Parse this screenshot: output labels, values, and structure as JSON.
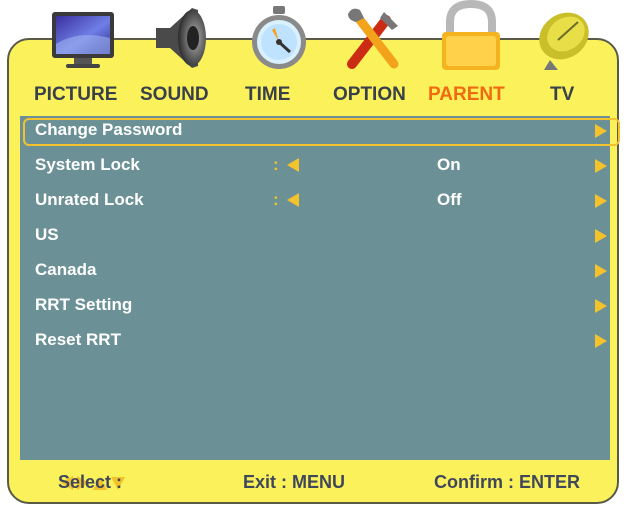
{
  "tabs": [
    {
      "label": "PICTURE",
      "icon": "monitor-icon"
    },
    {
      "label": "SOUND",
      "icon": "speaker-icon"
    },
    {
      "label": "TIME",
      "icon": "stopwatch-icon"
    },
    {
      "label": "OPTION",
      "icon": "tools-icon"
    },
    {
      "label": "PARENT",
      "icon": "padlock-icon",
      "active": true
    },
    {
      "label": "TV",
      "icon": "satellite-dish-icon"
    }
  ],
  "menu": [
    {
      "label": "Change Password",
      "selected": true
    },
    {
      "label": "System Lock",
      "colon": ":",
      "value": "On"
    },
    {
      "label": "Unrated Lock",
      "colon": ":",
      "value": "Off"
    },
    {
      "label": "US"
    },
    {
      "label": "Canada"
    },
    {
      "label": "RRT Setting"
    },
    {
      "label": "Reset RRT"
    }
  ],
  "footer": {
    "select": "Select :",
    "exit": "Exit : MENU",
    "confirm": "Confirm : ENTER"
  },
  "colors": {
    "frame": "#fbf25b",
    "menu_bg": "#6b9196",
    "accent": "#f4c22b",
    "active_tab": "#f06a12"
  }
}
